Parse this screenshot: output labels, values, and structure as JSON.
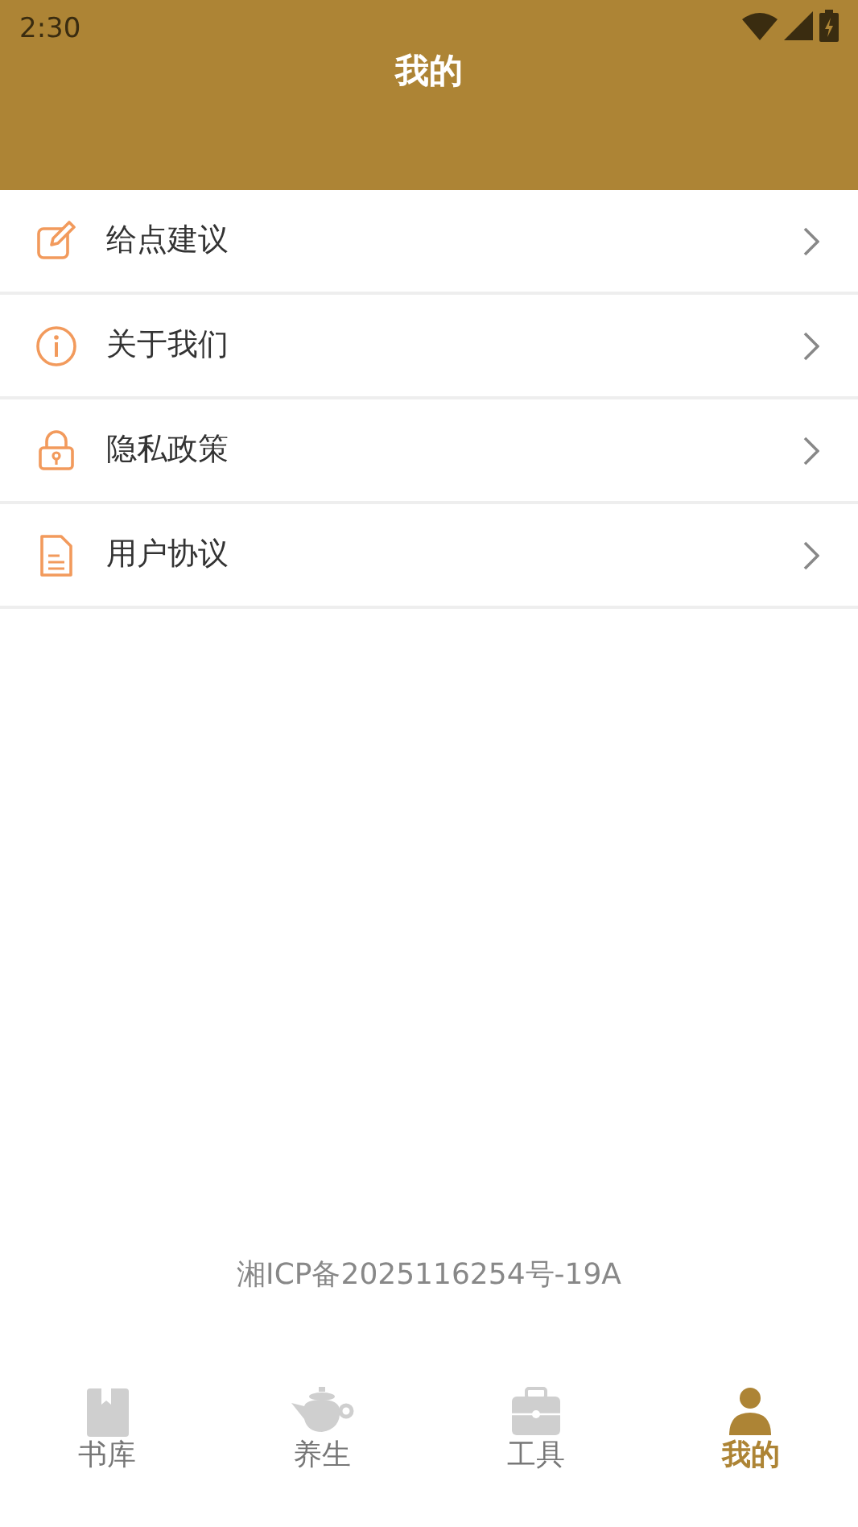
{
  "status_bar": {
    "time": "2:30"
  },
  "header": {
    "title": "我的"
  },
  "menu": [
    {
      "label": "给点建议"
    },
    {
      "label": "关于我们"
    },
    {
      "label": "隐私政策"
    },
    {
      "label": "用户协议"
    }
  ],
  "footer": {
    "icp": "湘ICP备2025116254号-19A"
  },
  "tabs": [
    {
      "label": "书库",
      "selected": false
    },
    {
      "label": "养生",
      "selected": false
    },
    {
      "label": "工具",
      "selected": false
    },
    {
      "label": "我的",
      "selected": true
    }
  ]
}
